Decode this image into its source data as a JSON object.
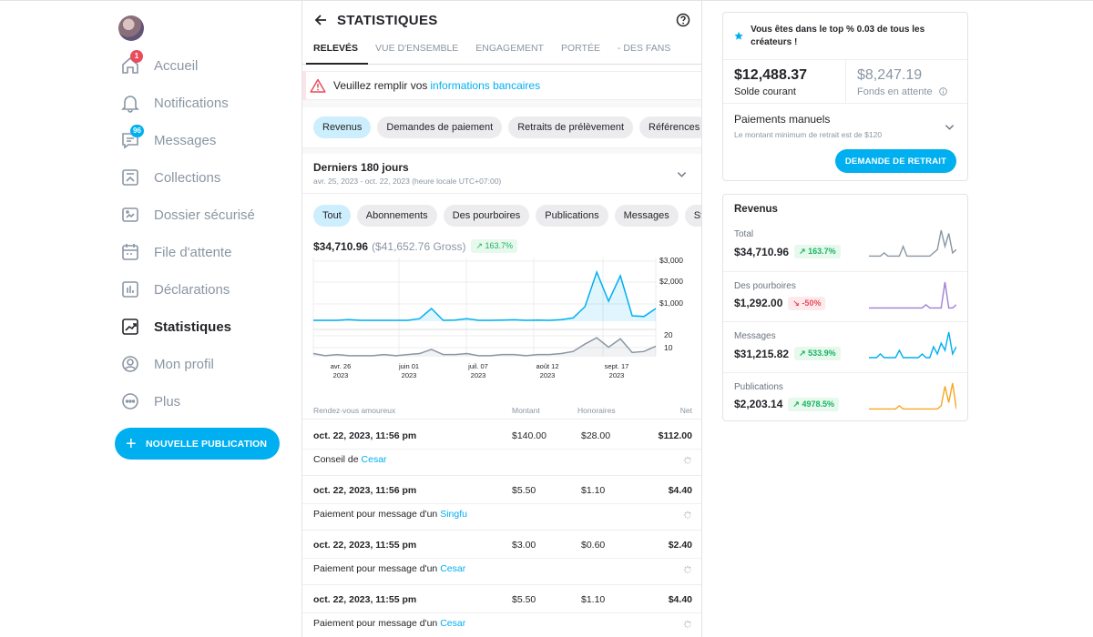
{
  "sidebar": {
    "items": [
      {
        "label": "Accueil",
        "icon": "home-icon",
        "badge": "1",
        "active": false
      },
      {
        "label": "Notifications",
        "icon": "bell-icon",
        "active": false
      },
      {
        "label": "Messages",
        "icon": "message-icon",
        "badge": "96",
        "active": false
      },
      {
        "label": "Collections",
        "icon": "collections-icon",
        "active": false
      },
      {
        "label": "Dossier sécurisé",
        "icon": "vault-icon",
        "active": false
      },
      {
        "label": "File d'attente",
        "icon": "calendar-icon",
        "active": false
      },
      {
        "label": "Déclarations",
        "icon": "statements-icon",
        "active": false
      },
      {
        "label": "Statistiques",
        "icon": "stats-icon",
        "active": true
      },
      {
        "label": "Mon profil",
        "icon": "profile-icon",
        "active": false
      },
      {
        "label": "Plus",
        "icon": "more-icon",
        "active": false
      }
    ],
    "new_post_label": "NOUVELLE PUBLICATION"
  },
  "header": {
    "title": "STATISTIQUES"
  },
  "tabs": [
    "RELEVÉS",
    "VUE D'ENSEMBLE",
    "ENGAGEMENT",
    "PORTÉE",
    "- DES FANS"
  ],
  "alert": {
    "text": "Veuillez remplir vos",
    "link": "informations bancaires"
  },
  "categories": [
    "Revenus",
    "Demandes de paiement",
    "Retraits de prélèvement",
    "Références"
  ],
  "period": {
    "title": "Derniers 180 jours",
    "subtitle": "avr. 25, 2023 - oct. 22, 2023 (heure locale UTC+07:00)"
  },
  "filters": [
    "Tout",
    "Abonnements",
    "Des pourboires",
    "Publications",
    "Messages",
    "Streams"
  ],
  "summary": {
    "net": "$34,710.96",
    "gross": "($41,652.76 Gross)",
    "change": "163.7%"
  },
  "chart_data": [
    {
      "type": "area",
      "x_ticks": [
        "avr. 26\n2023",
        "juin 01\n2023",
        "juil. 07\n2023",
        "août 12\n2023",
        "sept. 17\n2023"
      ],
      "y_ticks": [
        "$3,000",
        "$2,000",
        "$1,000"
      ],
      "ylim": [
        0,
        3500
      ],
      "values": [
        50,
        50,
        50,
        90,
        50,
        50,
        50,
        50,
        50,
        140,
        700,
        50,
        60,
        140,
        50,
        50,
        60,
        80,
        50,
        60,
        50,
        90,
        180,
        800,
        2700,
        1100,
        2500,
        300,
        260,
        700
      ],
      "color": "#00aff0"
    },
    {
      "type": "area",
      "y_ticks": [
        "20",
        "10"
      ],
      "ylim": [
        0,
        25
      ],
      "values": [
        3,
        1,
        2,
        1,
        1,
        1,
        2,
        1,
        2,
        3,
        7,
        2,
        2,
        3,
        1,
        1,
        2,
        2,
        1,
        2,
        2,
        3,
        5,
        12,
        18,
        9,
        17,
        4,
        5,
        10
      ],
      "color": "#8a96a3"
    }
  ],
  "table": {
    "headers": {
      "desc": "Rendez-vous amoureux",
      "amount": "Montant",
      "fees": "Honoraires",
      "net": "Net"
    },
    "rows": [
      {
        "date": "oct. 22, 2023, 11:56 pm",
        "amount": "$140.00",
        "fee": "$28.00",
        "net": "$112.00",
        "desc": "Conseil de",
        "user": "Cesar"
      },
      {
        "date": "oct. 22, 2023, 11:56 pm",
        "amount": "$5.50",
        "fee": "$1.10",
        "net": "$4.40",
        "desc": "Paiement pour message d'un",
        "user": "Singfu"
      },
      {
        "date": "oct. 22, 2023, 11:55 pm",
        "amount": "$3.00",
        "fee": "$0.60",
        "net": "$2.40",
        "desc": "Paiement pour message d'un",
        "user": "Cesar"
      },
      {
        "date": "oct. 22, 2023, 11:55 pm",
        "amount": "$5.50",
        "fee": "$1.10",
        "net": "$4.40",
        "desc": "Paiement pour message d'un",
        "user": "Cesar"
      }
    ]
  },
  "top_card": {
    "banner": "Vous êtes dans le top % 0.03 de tous les créateurs !",
    "current_balance": "$12,488.37",
    "current_label": "Solde courant",
    "pending_balance": "$8,247.19",
    "pending_label": "Fonds en attente",
    "manual_title": "Paiements manuels",
    "manual_sub": "Le montant minimum de retrait est de $120",
    "withdraw_label": "DEMANDE DE RETRAIT"
  },
  "revenue_card": {
    "title": "Revenus",
    "rows": [
      {
        "label": "Total",
        "value": "$34,710.96",
        "change": "163.7%",
        "trend": "up",
        "color": "#8a96a3",
        "spark": [
          1,
          1,
          1,
          1,
          2,
          1,
          1,
          1,
          1,
          4,
          1,
          1,
          1,
          1,
          1,
          1,
          1,
          2,
          3,
          9,
          4,
          8,
          2,
          3
        ]
      },
      {
        "label": "Des pourboires",
        "value": "$1,292.00",
        "change": "-50%",
        "trend": "down",
        "color": "#a07fd6",
        "spark": [
          1,
          1,
          1,
          1,
          1,
          1,
          1,
          1,
          1,
          1,
          1,
          1,
          1,
          1,
          1,
          2,
          1,
          1,
          1,
          1,
          9,
          1,
          1,
          2
        ]
      },
      {
        "label": "Messages",
        "value": "$31,215.82",
        "change": "533.9%",
        "trend": "up",
        "color": "#00aff0",
        "spark": [
          1,
          1,
          1,
          2,
          1,
          1,
          1,
          1,
          3,
          1,
          1,
          1,
          1,
          1,
          2,
          1,
          1,
          4,
          2,
          5,
          3,
          8,
          2,
          4
        ]
      },
      {
        "label": "Publications",
        "value": "$2,203.14",
        "change": "4978.5%",
        "trend": "up",
        "color": "#f5a623",
        "spark": [
          1,
          1,
          1,
          1,
          1,
          1,
          1,
          1,
          2,
          1,
          1,
          1,
          1,
          1,
          1,
          1,
          1,
          1,
          1,
          2,
          8,
          3,
          9,
          1
        ]
      }
    ]
  }
}
